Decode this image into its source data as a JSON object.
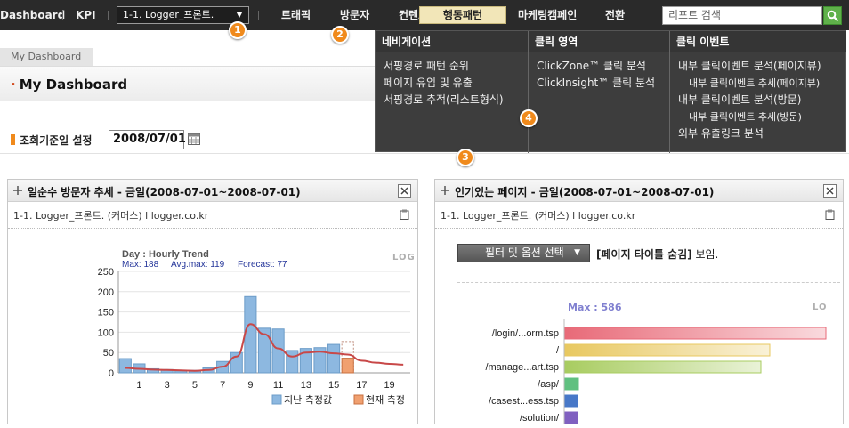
{
  "nav": {
    "dashboard": "Dashboard",
    "kpi": "KPI",
    "site_select": "1-1. Logger_프론트.",
    "menu": [
      "트래픽",
      "방문자",
      "컨텐츠",
      "행동패턴",
      "마케팅캠페인",
      "전환"
    ],
    "search_placeholder": "리포트 검색"
  },
  "badges": [
    "1",
    "2",
    "3",
    "4"
  ],
  "mega_menu": {
    "columns": [
      {
        "head": "네비게이션",
        "items": [
          "서핑경로 패턴 순위",
          "페이지 유입 및 유출",
          "서핑경로 추적(리스트형식)"
        ]
      },
      {
        "head": "클릭 영역",
        "items": [
          "ClickZone™ 클릭 분석",
          "ClickInsight™ 클릭 분석"
        ]
      },
      {
        "head": "클릭 이벤트",
        "items": [
          {
            "label": "내부 클릭이벤트 분석(페이지뷰)",
            "sub": false
          },
          {
            "label": "내부 클릭이벤트 추세(페이지뷰)",
            "sub": true
          },
          {
            "label": "내부 클릭이벤트 분석(방문)",
            "sub": false
          },
          {
            "label": "내부 클릭이벤트 추세(방문)",
            "sub": true
          },
          {
            "label": "외부 유출링크 분석",
            "sub": false
          }
        ]
      }
    ]
  },
  "page": {
    "tab": "My Dashboard",
    "title": "My Dashboard",
    "date_label": "조회기준일 설정",
    "date_value": "2008/07/01"
  },
  "widget1": {
    "title": "일순수 방문자 추세 - 금일(2008-07-01~2008-07-01)",
    "subtitle": "1-1. Logger_프론트. (커머스) l logger.co.kr",
    "logo": "LOG"
  },
  "widget2": {
    "title": "인기있는 페이지 - 금일(2008-07-01~2008-07-01)",
    "subtitle": "1-1. Logger_프론트. (커머스) l logger.co.kr",
    "filter_label": "필터 및 옵션 선택",
    "filter_note_bold": "[페이지 타이틀 숨김]",
    "filter_note": " 보임.",
    "max_label": "Max : 586",
    "logo": "LO"
  },
  "colors": {
    "nav_bg": "#2a2a2a",
    "accent_orange": "#f08a1c",
    "bar_past": "#8db8e0",
    "bar_current": "#f0a070",
    "trend_line": "#c84848"
  },
  "chart_data": [
    {
      "type": "bar",
      "title": "Day : Hourly Trend",
      "subtitle_items": [
        "Max: 188",
        "Avg.max: 119",
        "Forecast: 77"
      ],
      "x": [
        0,
        1,
        2,
        3,
        4,
        5,
        6,
        7,
        8,
        9,
        10,
        11,
        12,
        13,
        14,
        15,
        16,
        17,
        18,
        19,
        20
      ],
      "x_tick_labels": [
        "1",
        "3",
        "5",
        "7",
        "9",
        "11",
        "13",
        "15",
        "17",
        "19"
      ],
      "ylim": [
        0,
        250
      ],
      "y_ticks": [
        0,
        50,
        100,
        150,
        200,
        250
      ],
      "series": [
        {
          "name": "지난 측정값",
          "kind": "bar",
          "x": [
            0,
            1,
            2,
            3,
            4,
            5,
            6,
            7,
            8,
            9,
            10,
            11,
            12,
            13,
            14,
            15
          ],
          "values": [
            35,
            22,
            10,
            8,
            5,
            6,
            12,
            28,
            50,
            188,
            110,
            108,
            55,
            60,
            62,
            70
          ]
        },
        {
          "name": "현재 측정",
          "kind": "bar",
          "x": [
            16
          ],
          "values": [
            36
          ],
          "forecast_outline": 77
        },
        {
          "kind": "line",
          "x": [
            0,
            1,
            2,
            3,
            4,
            5,
            6,
            7,
            8,
            9,
            10,
            11,
            12,
            13,
            14,
            15,
            16,
            17,
            18,
            19,
            20
          ],
          "values": [
            12,
            10,
            8,
            7,
            6,
            5,
            7,
            15,
            40,
            120,
            95,
            60,
            40,
            50,
            52,
            48,
            45,
            30,
            25,
            22,
            20
          ]
        }
      ],
      "legend_placement": "bottom-right"
    },
    {
      "type": "bar",
      "orientation": "horizontal",
      "categories": [
        "/login/...orm.tsp",
        "/",
        "/manage...art.tsp",
        "/asp/",
        "/casest...ess.tsp",
        "/solution/"
      ],
      "values": [
        586,
        460,
        440,
        30,
        28,
        27
      ],
      "bar_colors": [
        "#e86a78",
        "#e8c860",
        "#a8cc60",
        "#60c080",
        "#4878c8",
        "#8060c0"
      ],
      "xlim": [
        0,
        600
      ]
    }
  ]
}
